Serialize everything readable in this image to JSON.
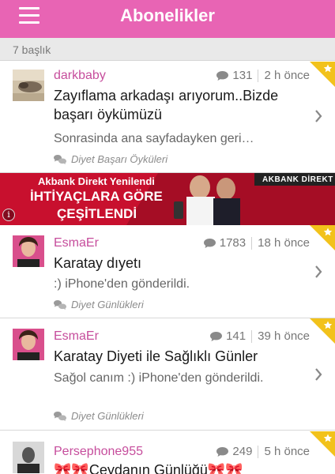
{
  "header": {
    "title": "Abonelikler",
    "menu_icon": "hamburger-menu-icon"
  },
  "count_label": "7 başlık",
  "colors": {
    "accent": "#e864b4",
    "author": "#c64d9c",
    "star": "#f2c21b",
    "banner": "#c8102e"
  },
  "ad": {
    "line1": "Akbank Direkt Yenilendi",
    "line2": "İHTİYAÇLARA GÖRE",
    "line3": "ÇEŞİTLENDİ",
    "brand": "AKBANK DİREKT",
    "info": "i"
  },
  "items": [
    {
      "author": "darkbaby",
      "comments": "131",
      "time": "2 h önce",
      "title": "Zayıflama arkadaşı arıyorum..Bizde başarı öykümüzü",
      "snippet": "Sonrasinda ana sayfadayken geri…",
      "category": "Diyet Başarı Öyküleri"
    },
    {
      "author": "EsmaEr",
      "comments": "1783",
      "time": "18 h önce",
      "title": "Karatay dıyetı",
      "snippet": ":) iPhone'den gönderildi.",
      "category": "Diyet Günlükleri"
    },
    {
      "author": "EsmaEr",
      "comments": "141",
      "time": "39 h önce",
      "title": "Karatay Diyeti ile Sağlıklı Günler",
      "snippet": "Sağol canım :) iPhone'den gönderildi.",
      "category": "Diyet Günlükleri"
    },
    {
      "author": "Persephone955",
      "comments": "249",
      "time": "5 h önce",
      "title": "🎀🎀Ceydanın Günlüğü🎀🎀",
      "snippet": "",
      "category": ""
    }
  ]
}
